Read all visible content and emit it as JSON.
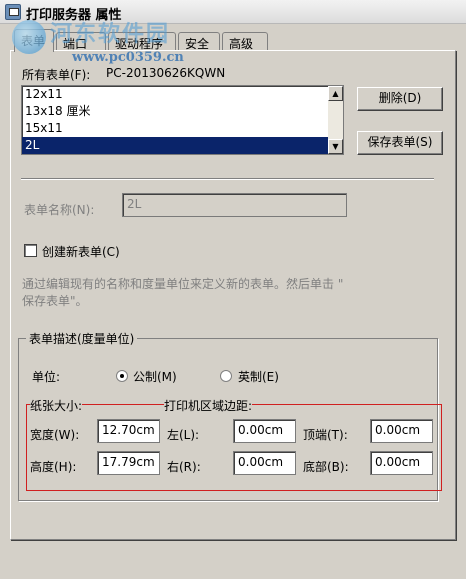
{
  "window": {
    "title": "打印服务器 属性"
  },
  "watermark": {
    "brand": "河东软件园",
    "url": "www.pc0359.cn"
  },
  "tabs": [
    {
      "label": "表单"
    },
    {
      "label": "端口"
    },
    {
      "label": "驱动程序"
    },
    {
      "label": "安全"
    },
    {
      "label": "高级"
    }
  ],
  "forms": {
    "label": "所有表单(F):",
    "server": "PC-20130626KQWN",
    "items": [
      "12x11",
      "13x18 厘米",
      "15x11",
      "2L"
    ],
    "selected": "2L",
    "delete_label": "删除(D)",
    "save_label": "保存表单(S)"
  },
  "form_name": {
    "label": "表单名称(N):",
    "value": "2L"
  },
  "create_new": {
    "label": "创建新表单(C)",
    "checked": false
  },
  "help_text": {
    "line1": "通过编辑现有的名称和度量单位来定义新的表单。然后单击 \"",
    "line2": "保存表单\"。"
  },
  "description": {
    "title": "表单描述(度量单位)",
    "unit_label": "单位:",
    "metric_label": "公制(M)",
    "imperial_label": "英制(E)",
    "selected_unit": "metric",
    "paper_size_label": "纸张大小:",
    "margins_label": "打印机区域边距:",
    "width_label": "宽度(W):",
    "width_value": "12.70cm",
    "height_label": "高度(H):",
    "height_value": "17.79cm",
    "left_label": "左(L):",
    "left_value": "0.00cm",
    "right_label": "右(R):",
    "right_value": "0.00cm",
    "top_label": "顶端(T):",
    "top_value": "0.00cm",
    "bottom_label": "底部(B):",
    "bottom_value": "0.00cm"
  },
  "colors": {
    "dialog_bg": "#d4d0c8",
    "selection": "#0a246a",
    "highlight_border": "#d02020"
  }
}
